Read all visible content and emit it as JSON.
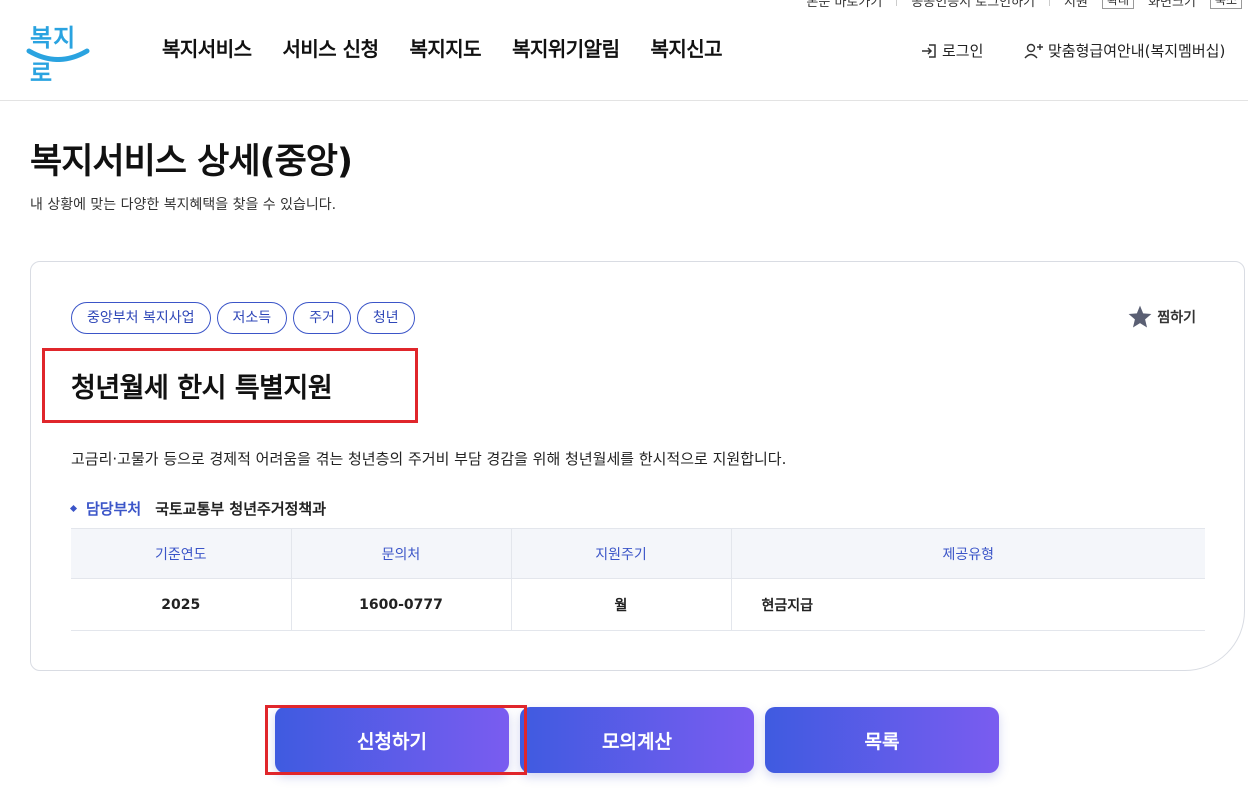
{
  "util_bar": {
    "items": [
      "본문 바로가기",
      "공공인증서 로그인하기",
      "지원"
    ],
    "boxes": [
      "확대",
      "화면크기",
      "축소"
    ]
  },
  "header": {
    "logo_text": "복지로",
    "nav": [
      "복지서비스",
      "서비스 신청",
      "복지지도",
      "복지위기알림",
      "복지신고"
    ],
    "login_label": "로그인",
    "member_label": "맞춤형급여안내(복지멤버십)"
  },
  "page": {
    "title": "복지서비스 상세(중앙)",
    "subtitle": "내 상황에 맞는 다양한 복지혜택을 찾을 수 있습니다."
  },
  "service": {
    "tags": [
      "중앙부처 복지사업",
      "저소득",
      "주거",
      "청년"
    ],
    "favorite_label": "찜하기",
    "title": "청년월세 한시 특별지원",
    "description": "고금리·고물가 등으로 경제적 어려움을 겪는 청년층의 주거비 부담 경감을 위해 청년월세를 한시적으로 지원합니다.",
    "dept_label": "담당부처",
    "dept_value": "국토교통부 청년주거정책과",
    "table": {
      "headers": [
        "기준연도",
        "문의처",
        "지원주기",
        "제공유형"
      ],
      "row": [
        "2025",
        "1600-0777",
        "월",
        "현금지급"
      ]
    }
  },
  "buttons": {
    "apply": "신청하기",
    "calc": "모의계산",
    "list": "목록"
  },
  "colors": {
    "accent": "#3b55c8",
    "highlight": "#e0262b",
    "button_gradient_start": "#3f5be0",
    "button_gradient_end": "#7a5cf0"
  }
}
